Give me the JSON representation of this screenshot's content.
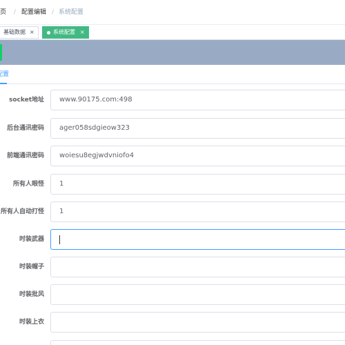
{
  "breadcrumb": {
    "home": "首页",
    "sep1": "/",
    "parent": "配置编辑",
    "sep2": "/",
    "current": "系统配置"
  },
  "tags": [
    {
      "label": "基础数据",
      "close": "×",
      "active": false
    },
    {
      "label": "系统配置",
      "close": "×",
      "active": true
    }
  ],
  "tabs": {
    "active_label": "配置"
  },
  "form": {
    "fields": [
      {
        "label": "socket地址",
        "value": "www.90175.com:498"
      },
      {
        "label": "后台通讯密码",
        "value": "ager058sdgieow323"
      },
      {
        "label": "前端通讯密码",
        "value": "woiesu8egjwdvniofo4"
      },
      {
        "label": "所有人眼怪",
        "value": "1"
      },
      {
        "label": "所有人自动打怪",
        "value": "1"
      },
      {
        "label": "时装武器",
        "value": ""
      },
      {
        "label": "时装帽子",
        "value": ""
      },
      {
        "label": "时装批风",
        "value": ""
      },
      {
        "label": "时装上衣",
        "value": ""
      }
    ]
  },
  "colors": {
    "accent": "#42b983",
    "banner": "#99abc4",
    "link_active": "#409eff",
    "focus_border": "#409eff"
  }
}
